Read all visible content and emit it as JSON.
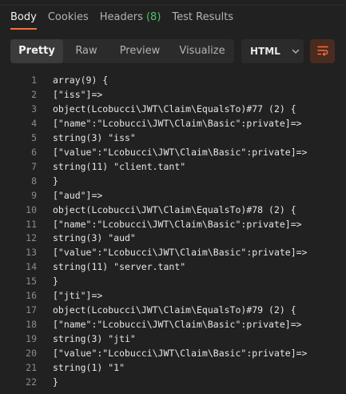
{
  "tabs": [
    {
      "label": "Body",
      "count": ""
    },
    {
      "label": "Cookies",
      "count": ""
    },
    {
      "label": "Headers",
      "count": "(8)"
    },
    {
      "label": "Test Results",
      "count": ""
    }
  ],
  "view_modes": [
    "Pretty",
    "Raw",
    "Preview",
    "Visualize"
  ],
  "format_select": {
    "value": "HTML",
    "icon": "chevron-down-icon"
  },
  "wrap_button": {
    "icon": "wrap-lines-icon"
  },
  "code_lines": [
    {
      "n": "1",
      "text": "array(9) {"
    },
    {
      "n": "2",
      "text": "[\"iss\"]=>"
    },
    {
      "n": "3",
      "text": "object(Lcobucci\\JWT\\Claim\\EqualsTo)#77 (2) {"
    },
    {
      "n": "4",
      "text": "[\"name\":\"Lcobucci\\JWT\\Claim\\Basic\":private]=>"
    },
    {
      "n": "5",
      "text": "string(3) \"iss\""
    },
    {
      "n": "6",
      "text": "[\"value\":\"Lcobucci\\JWT\\Claim\\Basic\":private]=>"
    },
    {
      "n": "7",
      "text": "string(11) \"client.tant\""
    },
    {
      "n": "8",
      "text": "}"
    },
    {
      "n": "9",
      "text": "[\"aud\"]=>"
    },
    {
      "n": "10",
      "text": "object(Lcobucci\\JWT\\Claim\\EqualsTo)#78 (2) {"
    },
    {
      "n": "11",
      "text": "[\"name\":\"Lcobucci\\JWT\\Claim\\Basic\":private]=>"
    },
    {
      "n": "12",
      "text": "string(3) \"aud\""
    },
    {
      "n": "13",
      "text": "[\"value\":\"Lcobucci\\JWT\\Claim\\Basic\":private]=>"
    },
    {
      "n": "14",
      "text": "string(11) \"server.tant\""
    },
    {
      "n": "15",
      "text": "}"
    },
    {
      "n": "16",
      "text": "[\"jti\"]=>"
    },
    {
      "n": "17",
      "text": "object(Lcobucci\\JWT\\Claim\\EqualsTo)#79 (2) {"
    },
    {
      "n": "18",
      "text": "[\"name\":\"Lcobucci\\JWT\\Claim\\Basic\":private]=>"
    },
    {
      "n": "19",
      "text": "string(3) \"jti\""
    },
    {
      "n": "20",
      "text": "[\"value\":\"Lcobucci\\JWT\\Claim\\Basic\":private]=>"
    },
    {
      "n": "21",
      "text": "string(1) \"1\""
    },
    {
      "n": "22",
      "text": "}"
    }
  ],
  "colors": {
    "background": "#212121",
    "accent": "#ff6c37",
    "count_green": "#4fc26b"
  }
}
